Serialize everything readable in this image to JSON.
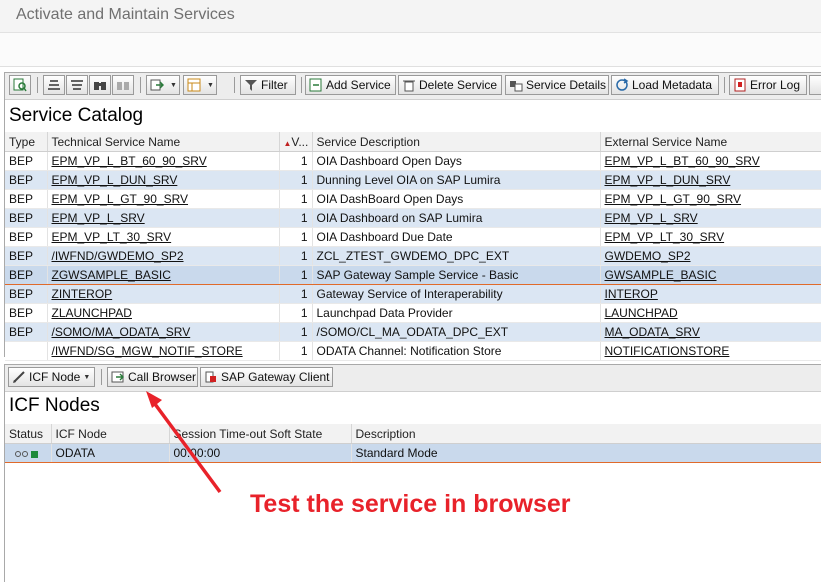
{
  "window": {
    "title": "Activate and Maintain Services"
  },
  "toolbar_top": {
    "filter_label": "Filter",
    "add_service_label": "Add Service",
    "delete_service_label": "Delete Service",
    "service_details_label": "Service Details",
    "load_metadata_label": "Load Metadata",
    "error_log_label": "Error Log"
  },
  "service_catalog": {
    "title": "Service Catalog",
    "columns": {
      "type": "Type",
      "technical_name": "Technical Service Name",
      "version": "V...",
      "description": "Service Description",
      "external_name": "External Service Name"
    },
    "rows": [
      {
        "type": "BEP",
        "technical_name": "EPM_VP_L_BT_60_90_SRV",
        "version": "1",
        "description": "OIA Dashboard Open Days",
        "external_name": "EPM_VP_L_BT_60_90_SRV"
      },
      {
        "type": "BEP",
        "technical_name": "EPM_VP_L_DUN_SRV",
        "version": "1",
        "description": "Dunning Level OIA on SAP Lumira",
        "external_name": "EPM_VP_L_DUN_SRV"
      },
      {
        "type": "BEP",
        "technical_name": "EPM_VP_L_GT_90_SRV",
        "version": "1",
        "description": "OIA DashBoard Open Days",
        "external_name": "EPM_VP_L_GT_90_SRV"
      },
      {
        "type": "BEP",
        "technical_name": "EPM_VP_L_SRV",
        "version": "1",
        "description": "OIA Dashboard on SAP Lumira",
        "external_name": "EPM_VP_L_SRV"
      },
      {
        "type": "BEP",
        "technical_name": "EPM_VP_LT_30_SRV",
        "version": "1",
        "description": "OIA Dashboard Due Date",
        "external_name": "EPM_VP_LT_30_SRV"
      },
      {
        "type": "BEP",
        "technical_name": "/IWFND/GWDEMO_SP2",
        "version": "1",
        "description": "ZCL_ZTEST_GWDEMO_DPC_EXT",
        "external_name": "GWDEMO_SP2"
      },
      {
        "type": "BEP",
        "technical_name": "ZGWSAMPLE_BASIC",
        "version": "1",
        "description": "SAP Gateway Sample Service - Basic",
        "external_name": "GWSAMPLE_BASIC"
      },
      {
        "type": "BEP",
        "technical_name": "ZINTEROP",
        "version": "1",
        "description": "Gateway Service of Interaperability",
        "external_name": "INTEROP"
      },
      {
        "type": "BEP",
        "technical_name": "ZLAUNCHPAD",
        "version": "1",
        "description": "Launchpad Data Provider",
        "external_name": "LAUNCHPAD"
      },
      {
        "type": "BEP",
        "technical_name": "/SOMO/MA_ODATA_SRV",
        "version": "1",
        "description": "/SOMO/CL_MA_ODATA_DPC_EXT",
        "external_name": "MA_ODATA_SRV"
      },
      {
        "type": "",
        "technical_name": "/IWFND/SG_MGW_NOTIF_STORE",
        "version": "1",
        "description": "ODATA Channel: Notification Store",
        "external_name": "NOTIFICATIONSTORE"
      }
    ]
  },
  "toolbar_bottom": {
    "icf_node_label": "ICF Node",
    "call_browser_label": "Call Browser",
    "gateway_client_label": "SAP Gateway Client"
  },
  "icf_nodes": {
    "title": "ICF Nodes",
    "columns": {
      "status": "Status",
      "icf_node": "ICF Node",
      "session_timeout": "Session Time-out Soft State",
      "description": "Description"
    },
    "rows": [
      {
        "icf_node": "ODATA",
        "session_timeout": "00:00:00",
        "description": "Standard Mode"
      }
    ]
  },
  "annotation": {
    "text": "Test the service in browser",
    "color": "#e8222a"
  }
}
